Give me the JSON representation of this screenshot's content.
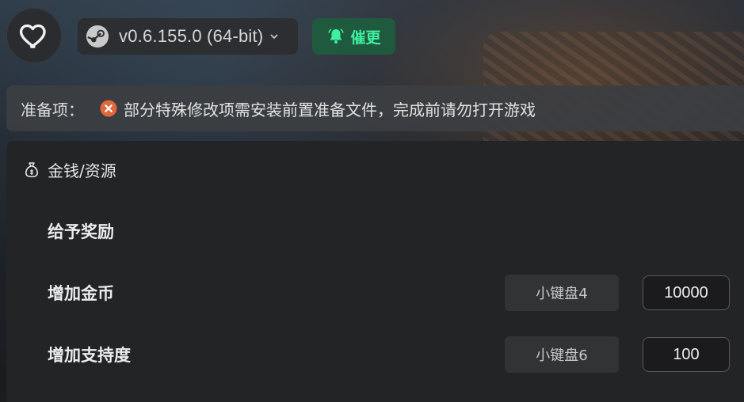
{
  "header": {
    "version": "v0.6.155.0 (64-bit)",
    "update_label": "催更",
    "icons": [
      "heart-icon",
      "steam-icon",
      "chevron-down-icon",
      "bell-icon"
    ]
  },
  "prep": {
    "label": "准备项：",
    "message": "部分特殊修改项需安装前置准备文件，完成前请勿打开游戏",
    "icon": "warning-x-icon"
  },
  "section": {
    "title": "金钱/资源",
    "icon": "money-bag-icon",
    "items": [
      {
        "label": "给予奖励"
      },
      {
        "label": "增加金币",
        "hotkey": "小键盘4",
        "value": "10000"
      },
      {
        "label": "增加支持度",
        "hotkey": "小键盘6",
        "value": "100"
      }
    ]
  },
  "colors": {
    "accent_green": "#3ff0a1",
    "update_bg": "#1f5a3e",
    "warn_orange": "#e0673a"
  }
}
